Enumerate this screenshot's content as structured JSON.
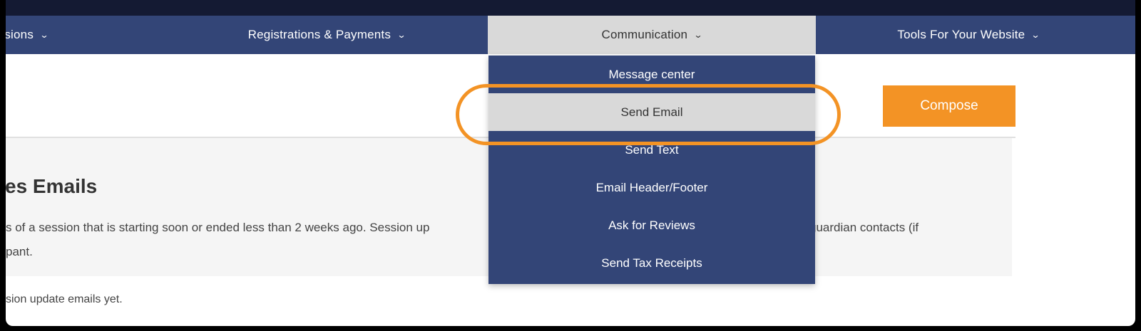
{
  "nav": {
    "items": [
      {
        "label": "essions",
        "chevron": "chevron-down-icon"
      },
      {
        "label": "Registrations & Payments",
        "chevron": "chevron-down-icon"
      },
      {
        "label": "Communication",
        "chevron": "chevron-down-icon"
      },
      {
        "label": "Tools For Your Website",
        "chevron": "chevron-down-icon"
      }
    ],
    "active": "Communication"
  },
  "dropdown": {
    "items": [
      {
        "label": "Message center"
      },
      {
        "label": "Send Email"
      },
      {
        "label": "Send Text"
      },
      {
        "label": "Email Header/Footer"
      },
      {
        "label": "Ask for Reviews"
      },
      {
        "label": "Send Tax Receipts"
      }
    ],
    "hovered": "Send Email"
  },
  "toolbar": {
    "compose_label": "Compose"
  },
  "panel": {
    "title": "es Emails",
    "text_line1_left": "s of a session that is starting soon or ended less than 2 weeks ago. Session up",
    "text_line1_right": "guardian contacts (if",
    "text_line2": "pant."
  },
  "empty_state": "sion update emails yet.",
  "colors": {
    "nav_bg": "#334577",
    "active_bg": "#d9d9d9",
    "accent": "#f39325",
    "panel_bg": "#f5f5f5"
  }
}
